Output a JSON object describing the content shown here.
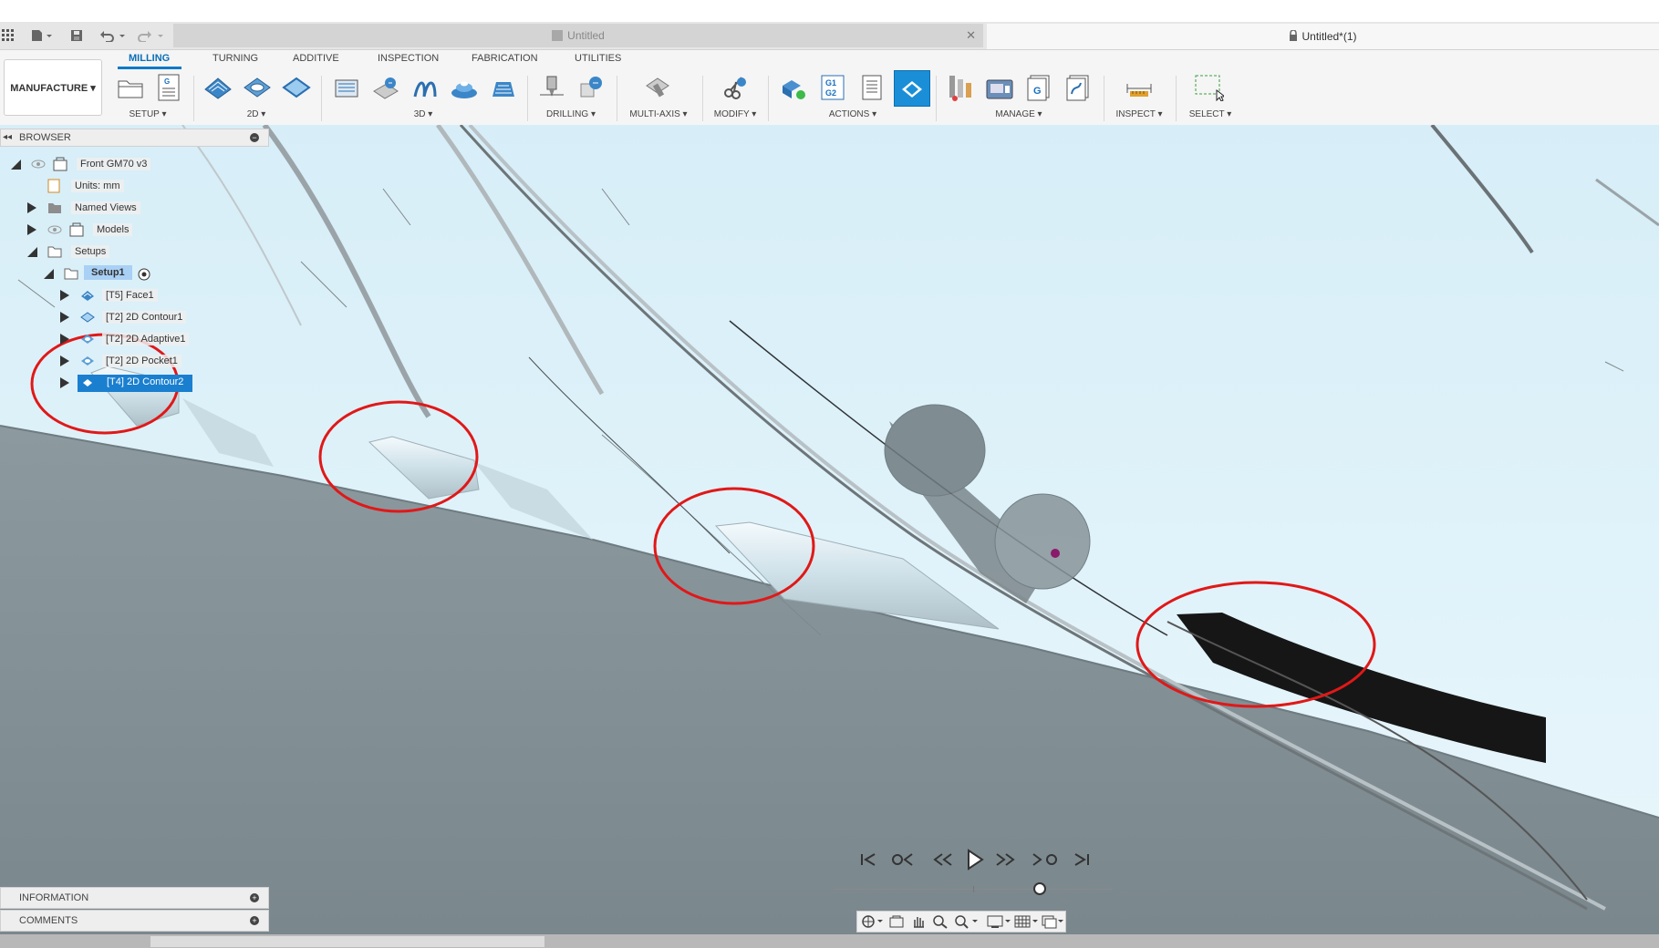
{
  "tabs": {
    "inactive_title": "Untitled",
    "active_title": "Untitled*(1)"
  },
  "ribbon": {
    "workspace": "MANUFACTURE ▾",
    "tabs": [
      "MILLING",
      "TURNING",
      "ADDITIVE",
      "INSPECTION",
      "FABRICATION",
      "UTILITIES"
    ],
    "active_tab": "MILLING",
    "groups": {
      "setup": "SETUP ▾",
      "g2d": "2D ▾",
      "g3d": "3D ▾",
      "drilling": "DRILLING ▾",
      "multiaxis": "MULTI-AXIS ▾",
      "modify": "MODIFY ▾",
      "actions": "ACTIONS ▾",
      "manage": "MANAGE ▾",
      "inspect": "INSPECT ▾",
      "select": "SELECT ▾"
    },
    "gcode_icon_text": "G1\nG2",
    "colors": {
      "accent": "#0a79c7",
      "selected_tool_bg": "#1a8fd8"
    }
  },
  "browser": {
    "title": "BROWSER",
    "document": "Front GM70 v3",
    "units": "Units: mm",
    "named_views": "Named Views",
    "models": "Models",
    "setups": "Setups",
    "setup1": "Setup1",
    "operations": [
      "[T5] Face1",
      "[T2] 2D Contour1",
      "[T2] 2D Adaptive1",
      "[T2] 2D Pocket1",
      "[T4] 2D Contour2"
    ],
    "selected_operation": "[T4] 2D Contour2"
  },
  "panels": {
    "information": "INFORMATION",
    "comments": "COMMENTS"
  },
  "viewport": {
    "annotation_color": "#e01818",
    "background": "#dff3fb"
  }
}
